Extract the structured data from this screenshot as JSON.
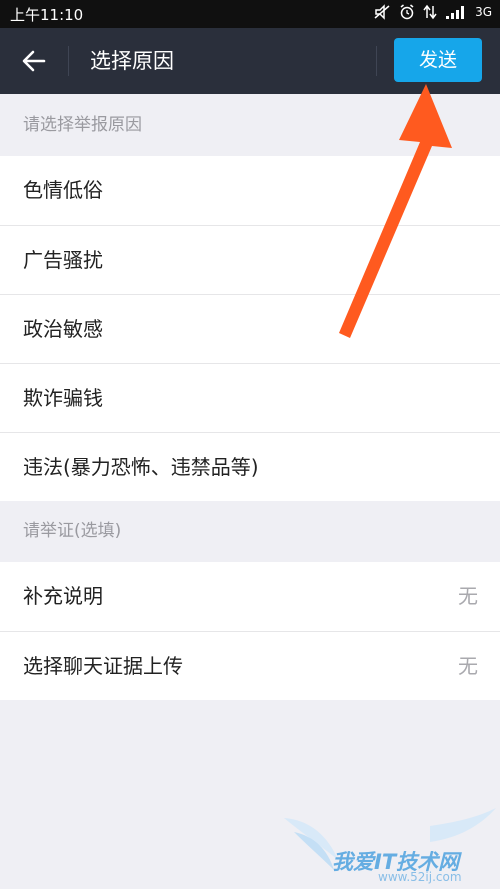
{
  "status_bar": {
    "time": "上午11:10",
    "network_label": "3G",
    "icons": [
      "silent-icon",
      "alarm-icon",
      "data-arrows-icon",
      "signal-icon"
    ]
  },
  "title_bar": {
    "back_icon": "arrow-left-icon",
    "title": "选择原因",
    "send_label": "发送",
    "send_color": "#16a6ea",
    "background": "#2a2f3b"
  },
  "reasons_section": {
    "header": "请选择举报原因",
    "items": [
      {
        "label": "色情低俗"
      },
      {
        "label": "广告骚扰"
      },
      {
        "label": "政治敏感"
      },
      {
        "label": "欺诈骗钱"
      },
      {
        "label": "违法(暴力恐怖、违禁品等)"
      }
    ]
  },
  "evidence_section": {
    "header": "请举证(选填)",
    "items": [
      {
        "label": "补充说明",
        "value": "无"
      },
      {
        "label": "选择聊天证据上传",
        "value": "无"
      }
    ]
  },
  "annotation": {
    "arrow_color": "#ff5a1f",
    "arrow_icon": "pointer-arrow-icon"
  },
  "watermark": {
    "title": "我爱IT技术网",
    "url": "www.52ij.com"
  }
}
